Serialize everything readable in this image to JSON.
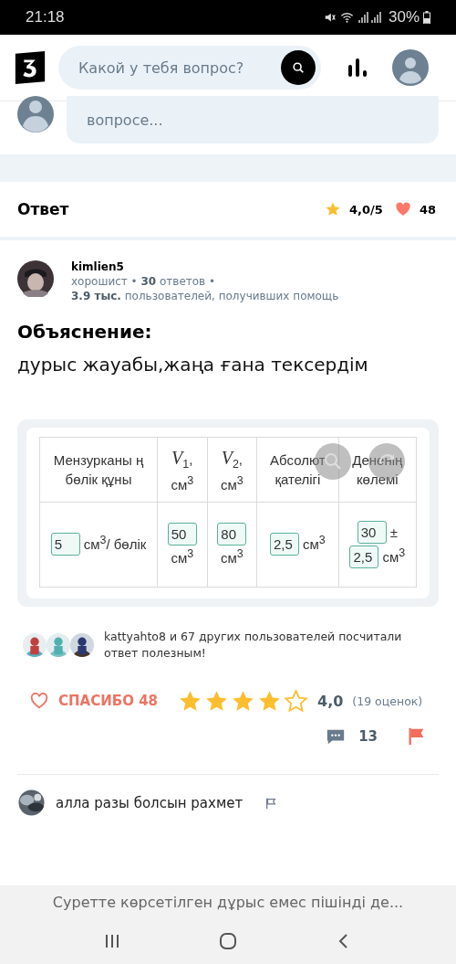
{
  "status_bar": {
    "time": "21:18",
    "battery": "30%"
  },
  "header": {
    "search": {
      "placeholder": "Какой у тебя вопрос?"
    }
  },
  "question_comment": {
    "text": "вопросе..."
  },
  "answer": {
    "title": "Ответ",
    "rating": "4,0/5",
    "likes": "48",
    "author": {
      "name": "kimlien5",
      "line_1": "хорошист • **30** ответов •",
      "line_2": "**3.9 тыс.** пользователей, получивших помощь"
    },
    "heading": "Объяснение:",
    "body": "дурыс жауабы,жаңа ғана тексердім",
    "table": {
      "columns": [
        "Мензурканы ң бөлік құны",
        "*V*$_{1}$, см$^{3}$",
        "*V*$_{2}$, см$^{3}$",
        "Абсолют қателігі",
        "Дененің көлемі"
      ],
      "row": [
        [
          {
            "kind": "field",
            "text": "5"
          },
          {
            "kind": "text",
            "text": "см$^{3}$/ бөлік"
          }
        ],
        [
          {
            "kind": "field",
            "text": "50"
          },
          {
            "kind": "text",
            "text": "см$^{3}$"
          }
        ],
        [
          {
            "kind": "field",
            "text": "80"
          },
          {
            "kind": "text",
            "text": "см$^{3}$"
          }
        ],
        [
          {
            "kind": "field",
            "text": "2,5"
          },
          {
            "kind": "text",
            "text": "см$^{3}$"
          }
        ],
        [
          {
            "kind": "field",
            "text": "30"
          },
          {
            "kind": "text",
            "text": "±"
          },
          {
            "kind": "field",
            "text": "2,5"
          },
          {
            "kind": "text",
            "text": "см$^{3}$"
          }
        ]
      ]
    },
    "helpful": {
      "text": "kattyahto8 и 67 других пользователей посчитали ответ полезным!"
    },
    "thanks": "СПАСИБО 48",
    "stars": 4,
    "score": "4,0",
    "votes": "(19 оценок)",
    "comments": "13"
  },
  "comment": {
    "text": "алла разы болсын рахмет"
  },
  "banner": {
    "text": "Суретте көрсетілген дұрыс емес пішінді де..."
  }
}
